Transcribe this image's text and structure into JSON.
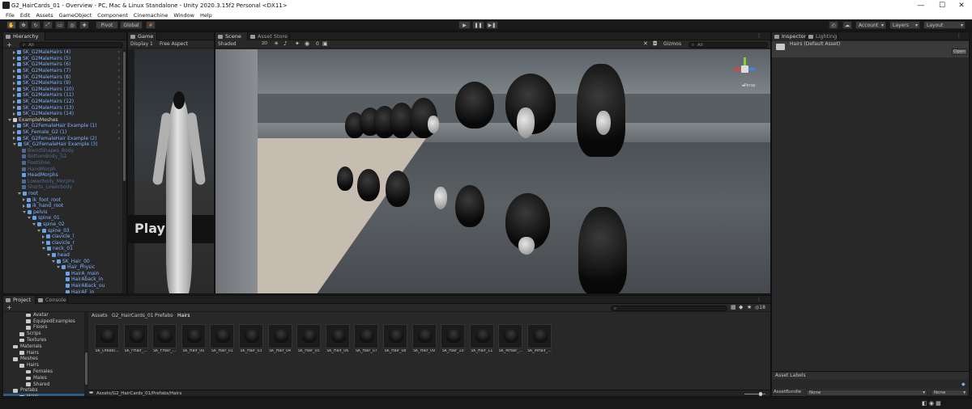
{
  "window": {
    "title": "G2_HairCards_01 - Overview - PC, Mac & Linux Standalone - Unity 2020.3.15f2 Personal <DX11>",
    "minimize": "—",
    "maximize": "☐",
    "close": "✕"
  },
  "menu": [
    "File",
    "Edit",
    "Assets",
    "GameObject",
    "Component",
    "Cinemachine",
    "Window",
    "Help"
  ],
  "toolbar": {
    "pivot": "Pivot",
    "global": "Global",
    "play": "▶",
    "pause": "❚❚",
    "step": "▶❚",
    "account": "Account",
    "layers": "Layers",
    "layout": "Layout"
  },
  "hierarchy": {
    "tab": "Hierarchy",
    "add": "+",
    "search": "All",
    "rows": [
      {
        "label": "SK_G2MaleHairs (4)",
        "indent": 1,
        "color": "#7fb2ff",
        "arrow": "closed"
      },
      {
        "label": "SK_G2MaleHairs (5)",
        "indent": 1,
        "color": "#7fb2ff",
        "arrow": "closed"
      },
      {
        "label": "SK_G2MaleHairs (6)",
        "indent": 1,
        "color": "#7fb2ff",
        "arrow": "closed"
      },
      {
        "label": "SK_G2MaleHairs (7)",
        "indent": 1,
        "color": "#7fb2ff",
        "arrow": "closed"
      },
      {
        "label": "SK_G2MaleHairs (8)",
        "indent": 1,
        "color": "#7fb2ff",
        "arrow": "closed"
      },
      {
        "label": "SK_G2MaleHairs (9)",
        "indent": 1,
        "color": "#7fb2ff",
        "arrow": "closed"
      },
      {
        "label": "SK_G2MaleHairs (10)",
        "indent": 1,
        "color": "#7fb2ff",
        "arrow": "closed"
      },
      {
        "label": "SK_G2MaleHairs (11)",
        "indent": 1,
        "color": "#7fb2ff",
        "arrow": "closed"
      },
      {
        "label": "SK_G2MaleHairs (12)",
        "indent": 1,
        "color": "#7fb2ff",
        "arrow": "closed"
      },
      {
        "label": "SK_G2MaleHairs (13)",
        "indent": 1,
        "color": "#7fb2ff",
        "arrow": "closed"
      },
      {
        "label": "SK_G2MaleHairs (14)",
        "indent": 1,
        "color": "#7fb2ff",
        "arrow": "closed"
      },
      {
        "label": "ExampleMeshes",
        "indent": 0,
        "color": "#d0d0d0",
        "arrow": "open"
      },
      {
        "label": "SK_G2FemaleHair Example (1)",
        "indent": 1,
        "color": "#7fb2ff",
        "arrow": "closed"
      },
      {
        "label": "SK_Female_G2 (1)",
        "indent": 1,
        "color": "#7fb2ff",
        "arrow": "closed"
      },
      {
        "label": "SK_G2FemaleHair Example (2)",
        "indent": 1,
        "color": "#7fb2ff",
        "arrow": "closed"
      },
      {
        "label": "SK_G2FemaleHair Example (3)",
        "indent": 1,
        "color": "#7fb2ff",
        "arrow": "open"
      },
      {
        "label": "BlendShapes_Body",
        "indent": 2,
        "color": "#4f6b94",
        "arrow": "none"
      },
      {
        "label": "BottomBody_G2",
        "indent": 2,
        "color": "#4f6b94",
        "arrow": "none"
      },
      {
        "label": "FeetShoe",
        "indent": 2,
        "color": "#4f6b94",
        "arrow": "none"
      },
      {
        "label": "HandMorph",
        "indent": 2,
        "color": "#4f6b94",
        "arrow": "none"
      },
      {
        "label": "HeadMorphs",
        "indent": 2,
        "color": "#7fb2ff",
        "arrow": "none"
      },
      {
        "label": "Lowerbody_Morphs",
        "indent": 2,
        "color": "#4f6b94",
        "arrow": "none"
      },
      {
        "label": "Shorts_Lowerbody",
        "indent": 2,
        "color": "#4f6b94",
        "arrow": "none"
      },
      {
        "label": "root",
        "indent": 2,
        "color": "#7fb2ff",
        "arrow": "open"
      },
      {
        "label": "ik_foot_root",
        "indent": 3,
        "color": "#7fb2ff",
        "arrow": "closed"
      },
      {
        "label": "ik_hand_root",
        "indent": 3,
        "color": "#7fb2ff",
        "arrow": "closed"
      },
      {
        "label": "pelvis",
        "indent": 3,
        "color": "#7fb2ff",
        "arrow": "open"
      },
      {
        "label": "spine_01",
        "indent": 4,
        "color": "#7fb2ff",
        "arrow": "open"
      },
      {
        "label": "spine_02",
        "indent": 5,
        "color": "#7fb2ff",
        "arrow": "open"
      },
      {
        "label": "spine_03",
        "indent": 6,
        "color": "#7fb2ff",
        "arrow": "open"
      },
      {
        "label": "clavicle_l",
        "indent": 7,
        "color": "#7fb2ff",
        "arrow": "closed"
      },
      {
        "label": "clavicle_r",
        "indent": 7,
        "color": "#7fb2ff",
        "arrow": "closed"
      },
      {
        "label": "neck_01",
        "indent": 7,
        "color": "#7fb2ff",
        "arrow": "open"
      },
      {
        "label": "head",
        "indent": 8,
        "color": "#7fb2ff",
        "arrow": "open"
      },
      {
        "label": "SK_Hair_00",
        "indent": 9,
        "color": "#7fb2ff",
        "arrow": "open"
      },
      {
        "label": "Hair_Physic",
        "indent": 10,
        "color": "#7fb2ff",
        "arrow": "open"
      },
      {
        "label": "HairA_main",
        "indent": 11,
        "color": "#7fb2ff",
        "arrow": "none"
      },
      {
        "label": "HairAback_in",
        "indent": 11,
        "color": "#7fb2ff",
        "arrow": "none"
      },
      {
        "label": "HairABack_ou",
        "indent": 11,
        "color": "#7fb2ff",
        "arrow": "none"
      },
      {
        "label": "HairAF_in",
        "indent": 11,
        "color": "#7fb2ff",
        "arrow": "none"
      },
      {
        "label": "HairAF_out",
        "indent": 11,
        "color": "#7fb2ff",
        "arrow": "none"
      }
    ]
  },
  "game": {
    "tab": "Game",
    "display": "Display 1",
    "aspect": "Free Aspect",
    "overlay_text": "Play o"
  },
  "scene": {
    "tab": "Scene",
    "tab2": "Asset Store",
    "shading": "Shaded",
    "mode": "2D",
    "gizmos": "Gizmos",
    "search": "All",
    "persp": "◄Persp",
    "fx_count": "0"
  },
  "inspector": {
    "tab": "Inspector",
    "tab2": "Lighting",
    "asset_name": "Hairs (Default Asset)",
    "open_button": "Open",
    "labels_title": "Asset Labels",
    "assetbundle_label": "AssetBundle",
    "bundle_value": "None",
    "variant_value": "None"
  },
  "project": {
    "tab": "Project",
    "tab2": "Console",
    "add": "+",
    "breadcrumb": [
      "Assets",
      "G2_HairCards_01",
      "Prefabs",
      "Hairs"
    ],
    "count": "18",
    "path": "Assets/G2_HairCards_01/Prefabs/Hairs",
    "tree": [
      {
        "label": "Avatar",
        "indent": 3
      },
      {
        "label": "EquipedExamples",
        "indent": 3
      },
      {
        "label": "Floors",
        "indent": 3
      },
      {
        "label": "Scrips",
        "indent": 2
      },
      {
        "label": "Textures",
        "indent": 2
      },
      {
        "label": "Materials",
        "indent": 1
      },
      {
        "label": "Hairs",
        "indent": 2
      },
      {
        "label": "Meshes",
        "indent": 1
      },
      {
        "label": "Hairs",
        "indent": 2
      },
      {
        "label": "Females",
        "indent": 3
      },
      {
        "label": "Males",
        "indent": 3
      },
      {
        "label": "Shared",
        "indent": 3
      },
      {
        "label": "Prefabs",
        "indent": 1
      },
      {
        "label": "Hairs",
        "indent": 2
      }
    ],
    "assets": [
      "SK_Dreadl...",
      "SK_FHair_...",
      "SK_FHair_...",
      "SK_Hair_00",
      "SK_Hair_01",
      "SK_Hair_03",
      "SK_Hair_04",
      "SK_Hair_05",
      "SK_Hair_06",
      "SK_Hair_07",
      "SK_Hair_08",
      "SK_Hair_09",
      "SK_Hair_10",
      "SK_Hair_11",
      "SK_MHair_...",
      "SK_MHair_..."
    ]
  }
}
